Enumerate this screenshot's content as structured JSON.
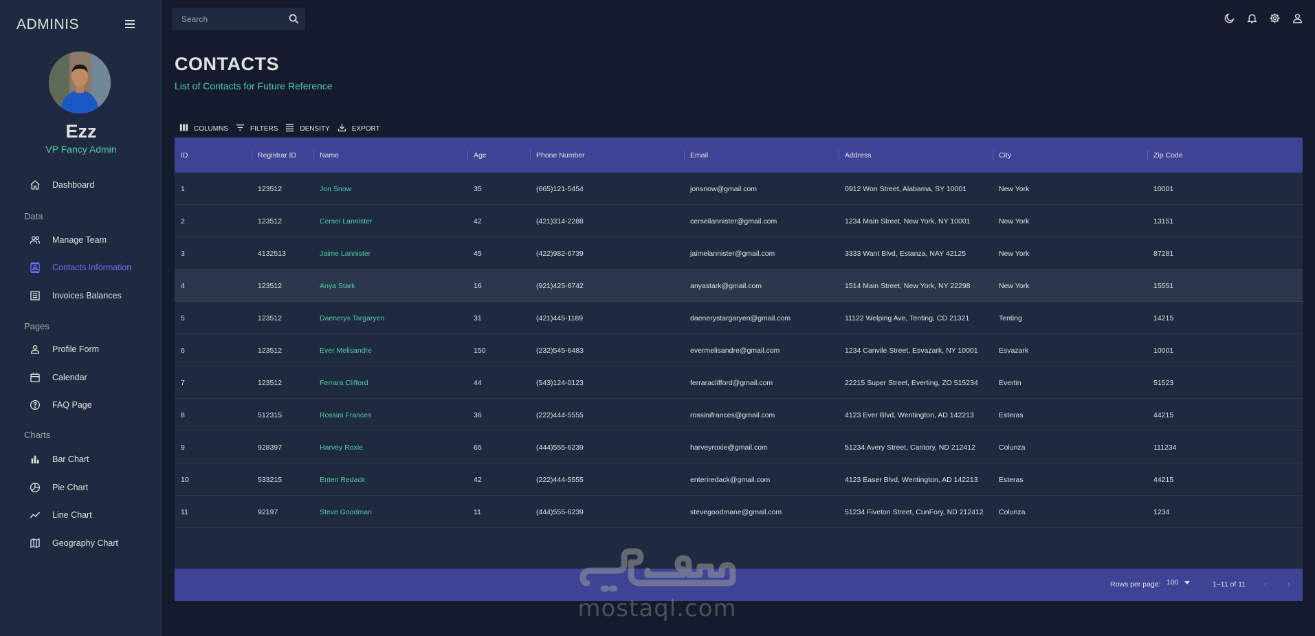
{
  "brand": "ADMINIS",
  "profile": {
    "name": "Ezz",
    "role": "VP Fancy Admin"
  },
  "sidebar": {
    "items": [
      {
        "label": "Dashboard",
        "icon": "home-icon"
      },
      {
        "section": "Data"
      },
      {
        "label": "Manage Team",
        "icon": "people-icon"
      },
      {
        "label": "Contacts Information",
        "icon": "contact-card-icon",
        "active": true
      },
      {
        "label": "Invoices Balances",
        "icon": "receipt-icon"
      },
      {
        "section": "Pages"
      },
      {
        "label": "Profile Form",
        "icon": "person-icon"
      },
      {
        "label": "Calendar",
        "icon": "calendar-icon"
      },
      {
        "label": "FAQ Page",
        "icon": "help-circle-icon"
      },
      {
        "section": "Charts"
      },
      {
        "label": "Bar Chart",
        "icon": "bar-chart-icon"
      },
      {
        "label": "Pie Chart",
        "icon": "pie-chart-icon"
      },
      {
        "label": "Line Chart",
        "icon": "line-chart-icon"
      },
      {
        "label": "Geography Chart",
        "icon": "map-icon"
      }
    ]
  },
  "search": {
    "placeholder": "Search"
  },
  "topbar_icons": [
    "dark-mode-icon",
    "notifications-icon",
    "settings-icon",
    "account-icon"
  ],
  "header": {
    "title": "CONTACTS",
    "subtitle": "List of Contacts for Future Reference"
  },
  "toolbar": {
    "columns": "Columns",
    "filters": "Filters",
    "density": "Density",
    "export": "Export"
  },
  "table": {
    "columns": [
      "ID",
      "Registrar ID",
      "Name",
      "Age",
      "Phone Number",
      "Email",
      "Address",
      "City",
      "Zip Code"
    ],
    "rows": [
      [
        "1",
        "123512",
        "Jon Snow",
        "35",
        "(665)121-5454",
        "jonsnow@gmail.com",
        "0912 Won Street, Alabama, SY 10001",
        "New York",
        "10001"
      ],
      [
        "2",
        "123512",
        "Cersei Lannister",
        "42",
        "(421)314-2288",
        "cerseilannister@gmail.com",
        "1234 Main Street, New York, NY 10001",
        "New York",
        "13151"
      ],
      [
        "3",
        "4132513",
        "Jaime Lannister",
        "45",
        "(422)982-6739",
        "jaimelannister@gmail.com",
        "3333 Want Blvd, Estanza, NAY 42125",
        "New York",
        "87281"
      ],
      [
        "4",
        "123512",
        "Anya Stark",
        "16",
        "(921)425-6742",
        "anyastark@gmail.com",
        "1514 Main Street, New York, NY 22298",
        "New York",
        "15551"
      ],
      [
        "5",
        "123512",
        "Daenerys Targaryen",
        "31",
        "(421)445-1189",
        "daenerystargaryen@gmail.com",
        "11122 Welping Ave, Tenting, CD 21321",
        "Tenting",
        "14215"
      ],
      [
        "6",
        "123512",
        "Ever Melisandre",
        "150",
        "(232)545-6483",
        "evermelisandre@gmail.com",
        "1234 Canvile Street, Esvazark, NY 10001",
        "Esvazark",
        "10001"
      ],
      [
        "7",
        "123512",
        "Ferrara Clifford",
        "44",
        "(543)124-0123",
        "ferraraclifford@gmail.com",
        "22215 Super Street, Everting, ZO 515234",
        "Evertin",
        "51523"
      ],
      [
        "8",
        "512315",
        "Rossini Frances",
        "36",
        "(222)444-5555",
        "rossinifrances@gmail.com",
        "4123 Ever Blvd, Wentington, AD 142213",
        "Esteras",
        "44215"
      ],
      [
        "9",
        "928397",
        "Harvey Roxie",
        "65",
        "(444)555-6239",
        "harveyroxie@gmail.com",
        "51234 Avery Street, Cantory, ND 212412",
        "Colunza",
        "111234"
      ],
      [
        "10",
        "533215",
        "Enteri Redack",
        "42",
        "(222)444-5555",
        "enteriredack@gmail.com",
        "4123 Easer Blvd, Wentington, AD 142213",
        "Esteras",
        "44215"
      ],
      [
        "11",
        "92197",
        "Steve Goodman",
        "11",
        "(444)555-6239",
        "stevegoodmane@gmail.com",
        "51234 Fiveton Street, CunFory, ND 212412",
        "Colunza",
        "1234"
      ]
    ],
    "highlighted_row": 4
  },
  "footer": {
    "rows_per_page_label": "Rows per page:",
    "rows_per_page_value": "100",
    "range": "1–11 of 11"
  },
  "watermark": {
    "logo_text": "مستقل",
    "text": "mostaql.com"
  },
  "colors": {
    "accent_green": "#4cceac",
    "accent_blue": "#6870fa",
    "header_bg": "#3e4396",
    "panel_bg": "#1f2a40",
    "page_bg": "#141b2d"
  }
}
